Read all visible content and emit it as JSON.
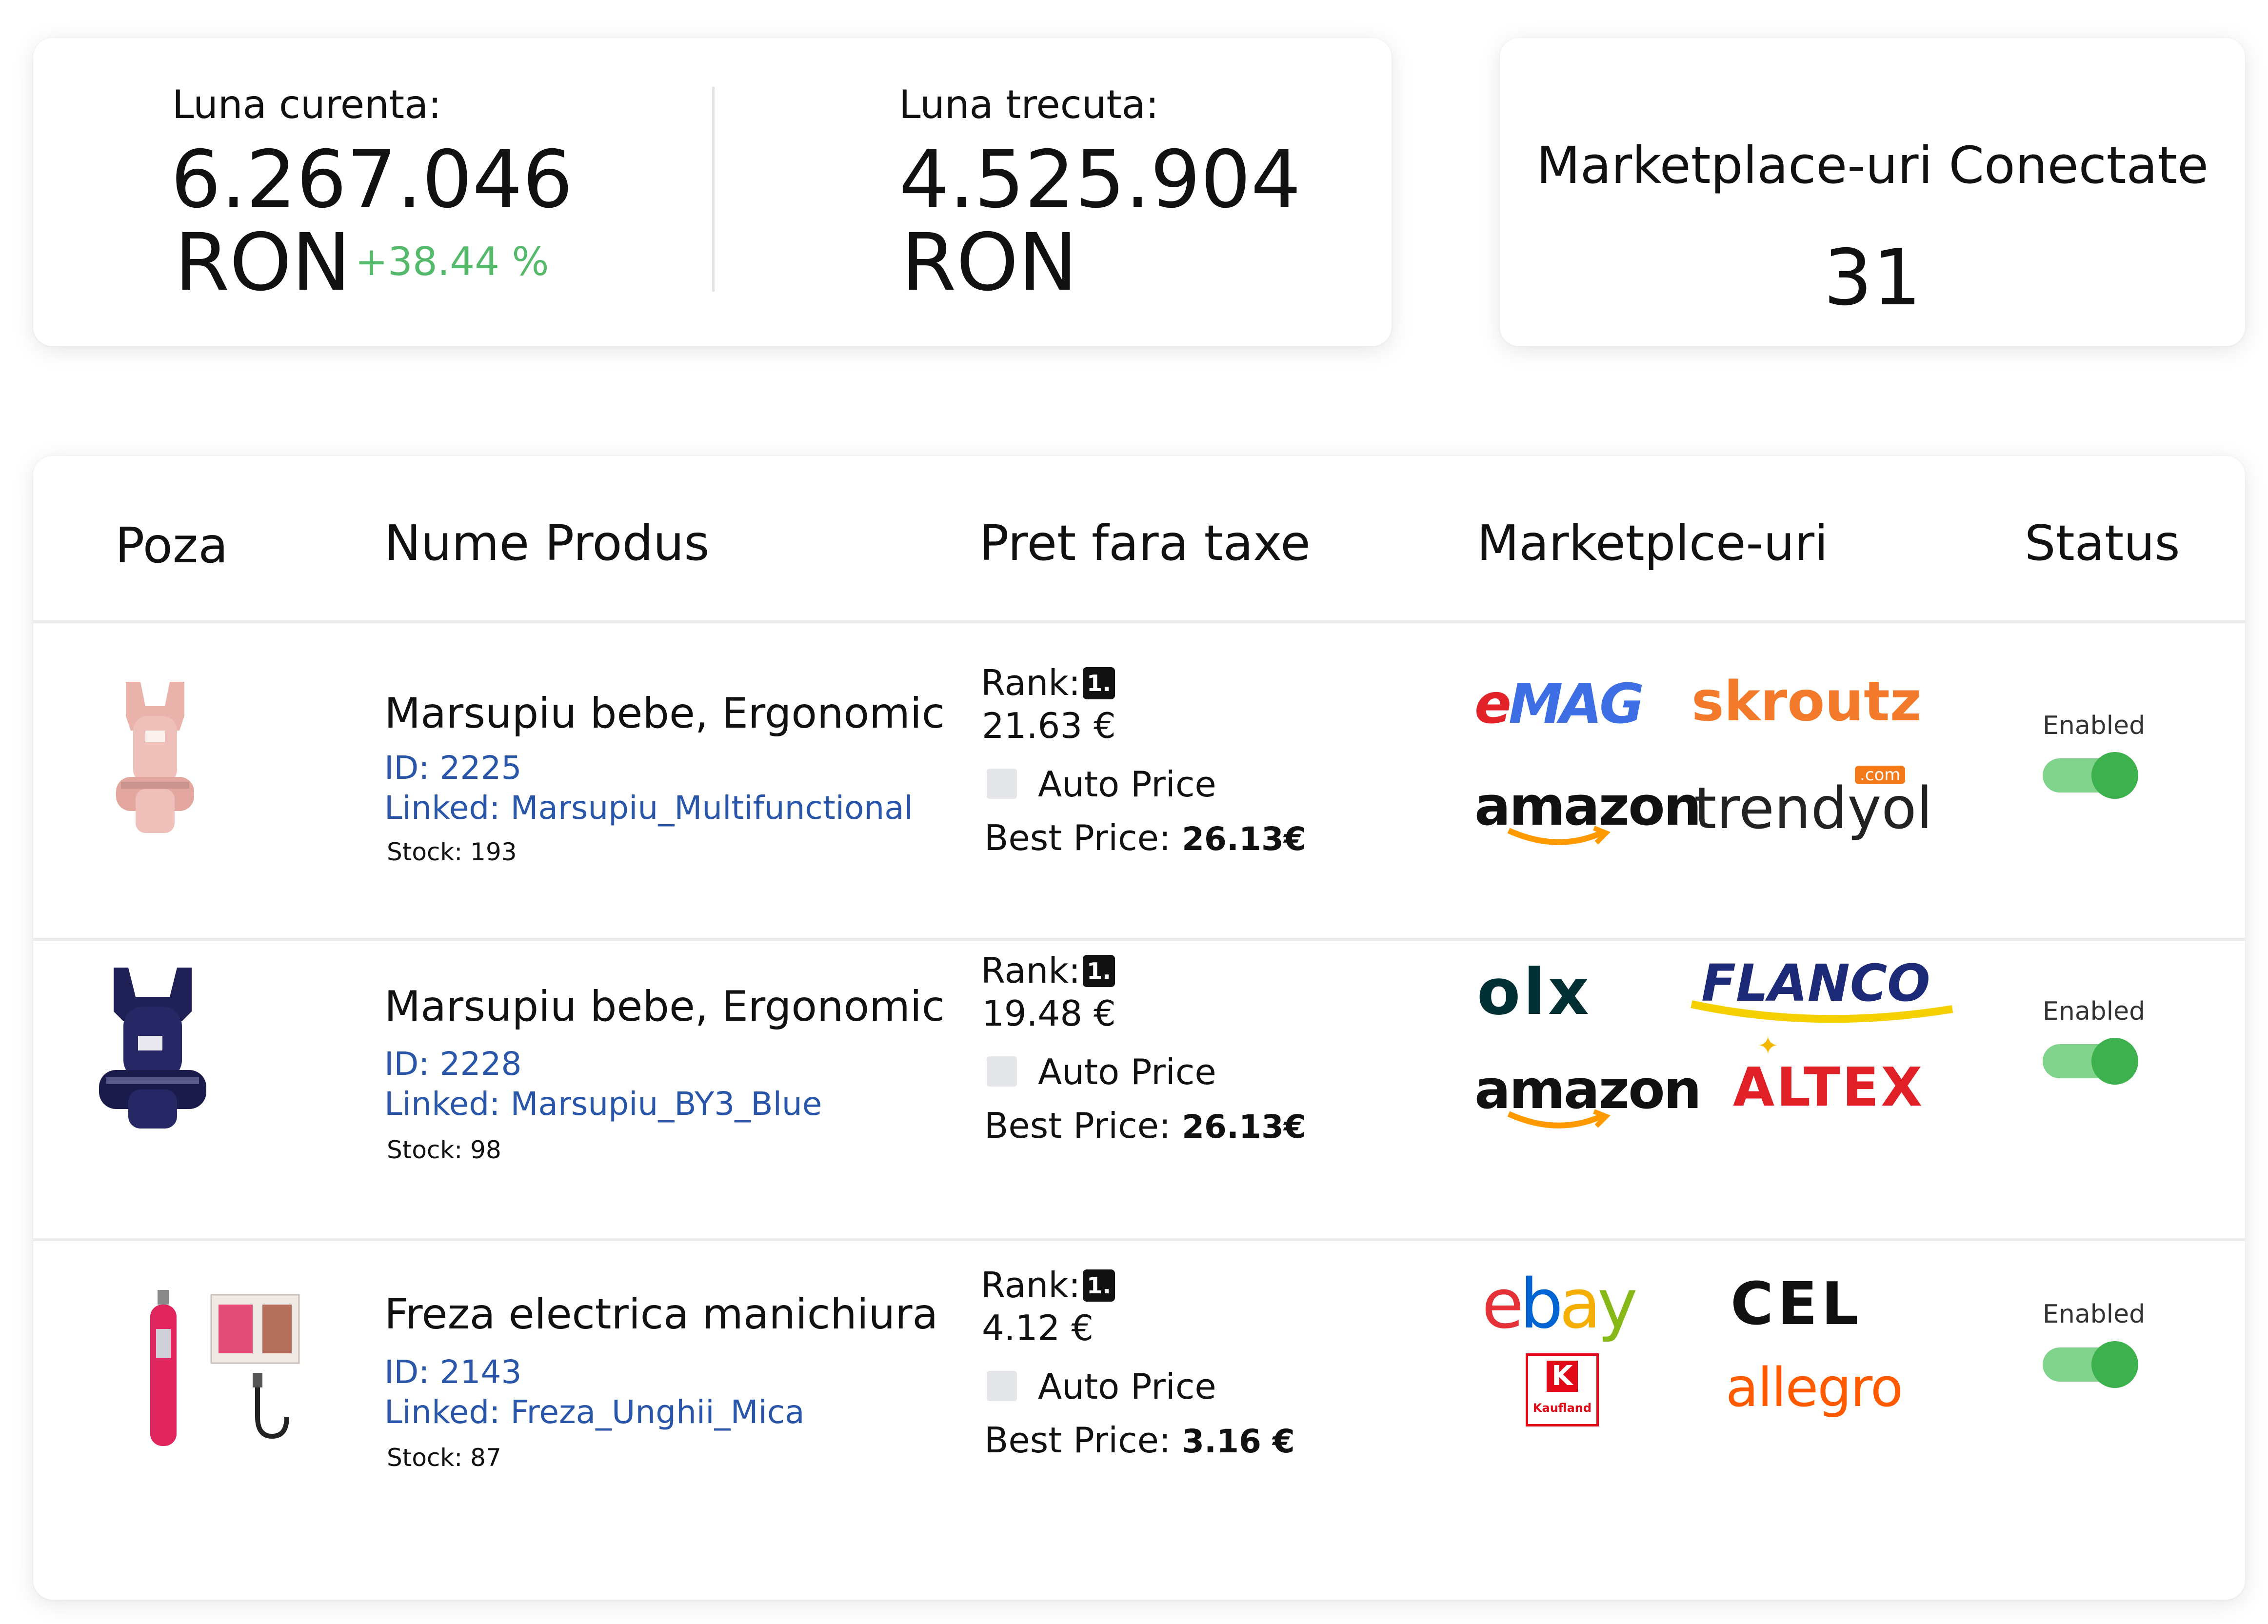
{
  "stats": {
    "current_label": "Luna curenta:",
    "current_value": "6.267.046",
    "current_unit": "RON",
    "change": "+38.44 %",
    "previous_label": "Luna trecuta:",
    "previous_value": "4.525.904",
    "previous_unit": "RON",
    "change_color": "#55b96b"
  },
  "marketplaces_card": {
    "title": "Marketplace-uri Conectate",
    "count": "31"
  },
  "table": {
    "headers": [
      "Poza",
      "Nume Produs",
      "Pret fara taxe",
      "Marketplce-uri",
      "Status"
    ],
    "rows": [
      {
        "image": "baby-carrier-pink",
        "name": "Marsupiu bebe, Ergonomic",
        "id": "ID: 2225",
        "linked": "Linked: Marsupiu_Multifunctional",
        "stock_label": "Stock:",
        "stock": "193",
        "rank_label": "Rank:",
        "rank": "1.",
        "price": "21.63 €",
        "auto_price": "Auto Price",
        "best_price_label": "Best Price:",
        "best_price": "26.13€",
        "marketplaces": [
          "emag",
          "skroutz",
          "amazon",
          "trendyol"
        ],
        "status": "Enabled"
      },
      {
        "image": "baby-carrier-navy",
        "name": "Marsupiu bebe, Ergonomic",
        "id": "ID: 2228",
        "linked": "Linked: Marsupiu_BY3_Blue",
        "stock_label": "Stock:",
        "stock": "98",
        "rank_label": "Rank:",
        "rank": "1.",
        "price": "19.48 €",
        "auto_price": "Auto Price",
        "best_price_label": "Best Price:",
        "best_price": "26.13€",
        "marketplaces": [
          "olx",
          "flanco",
          "amazon",
          "altex"
        ],
        "status": "Enabled"
      },
      {
        "image": "nail-drill-pink",
        "name": "Freza electrica manichiura",
        "id": "ID: 2143",
        "linked": "Linked: Freza_Unghii_Mica",
        "stock_label": "Stock:",
        "stock": "87",
        "rank_label": "Rank:",
        "rank": "1.",
        "price": "4.12 €",
        "auto_price": "Auto Price",
        "best_price_label": "Best Price:",
        "best_price": "3.16 €",
        "marketplaces": [
          "ebay",
          "cel",
          "kaufland",
          "allegro"
        ],
        "status": "Enabled"
      }
    ]
  },
  "logos": {
    "emag": "eMAG",
    "skroutz": "skroutz",
    "amazon": "amazon",
    "trendyol": "trendyol",
    "trendyol_badge": ".com",
    "olx": "olx",
    "flanco": "FLANCO",
    "altex": "ALTEX",
    "ebay": "ebay",
    "cel": "CEL",
    "kaufland": "Kaufland",
    "allegro": "allegro"
  },
  "colors": {
    "link_blue": "#2a56a9",
    "toggle_on": "#3cb14e",
    "emag_red": "#e2232a",
    "emag_blue": "#3d6ee3",
    "skroutz_orange": "#f37a2b",
    "amazon_orange": "#ff9900",
    "trendyol_orange": "#f27a1a",
    "olx_dark": "#002f34",
    "flanco_blue": "#1d2a77",
    "flanco_yellow": "#f5d000",
    "altex_red": "#e01f26",
    "kaufland_red": "#e10915",
    "allegro_orange": "#ff5a00"
  }
}
